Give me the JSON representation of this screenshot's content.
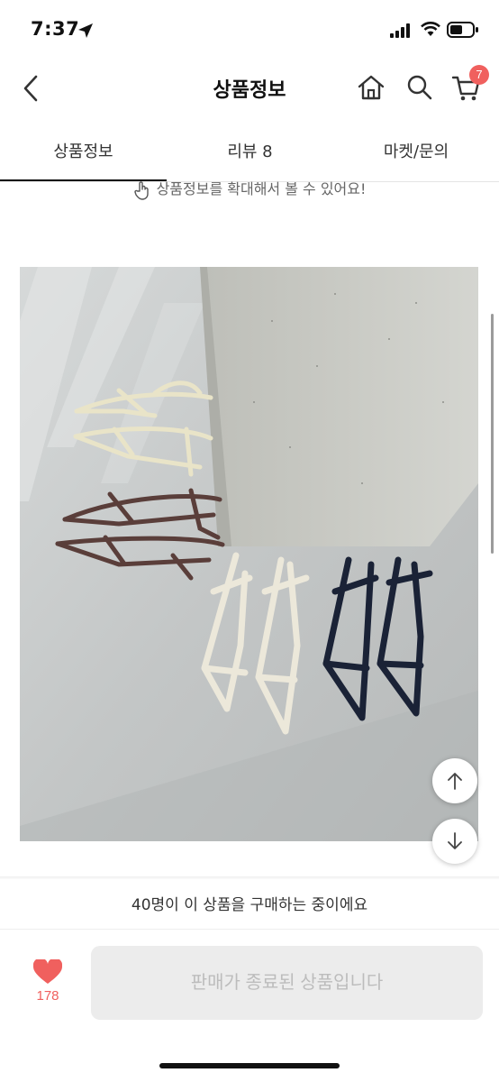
{
  "status_bar": {
    "time": "7:37",
    "icons": [
      "location-arrow-icon",
      "cellular-signal-icon",
      "wifi-icon",
      "battery-icon"
    ]
  },
  "header": {
    "title": "상품정보",
    "icons": [
      "back-arrow-icon",
      "home-icon",
      "search-icon",
      "cart-icon"
    ],
    "cart_badge": "7"
  },
  "tabs": [
    {
      "label": "상품정보",
      "active": true
    },
    {
      "label": "리뷰 8",
      "active": false
    },
    {
      "label": "마켓/문의",
      "active": false
    }
  ],
  "hint": "상품정보를 확대해서 볼 수 있어요!",
  "product_image": {
    "description_icon": "product-photo"
  },
  "purchase_note": "40명이 이 상품을 구매하는 중이에요",
  "like": {
    "count": "178"
  },
  "sold_out_button": {
    "label": "판매가 종료된 상품입니다"
  },
  "colors": {
    "accent": "#f0605e",
    "disabled_bg": "#ececec",
    "disabled_text": "#bcbcbc"
  }
}
